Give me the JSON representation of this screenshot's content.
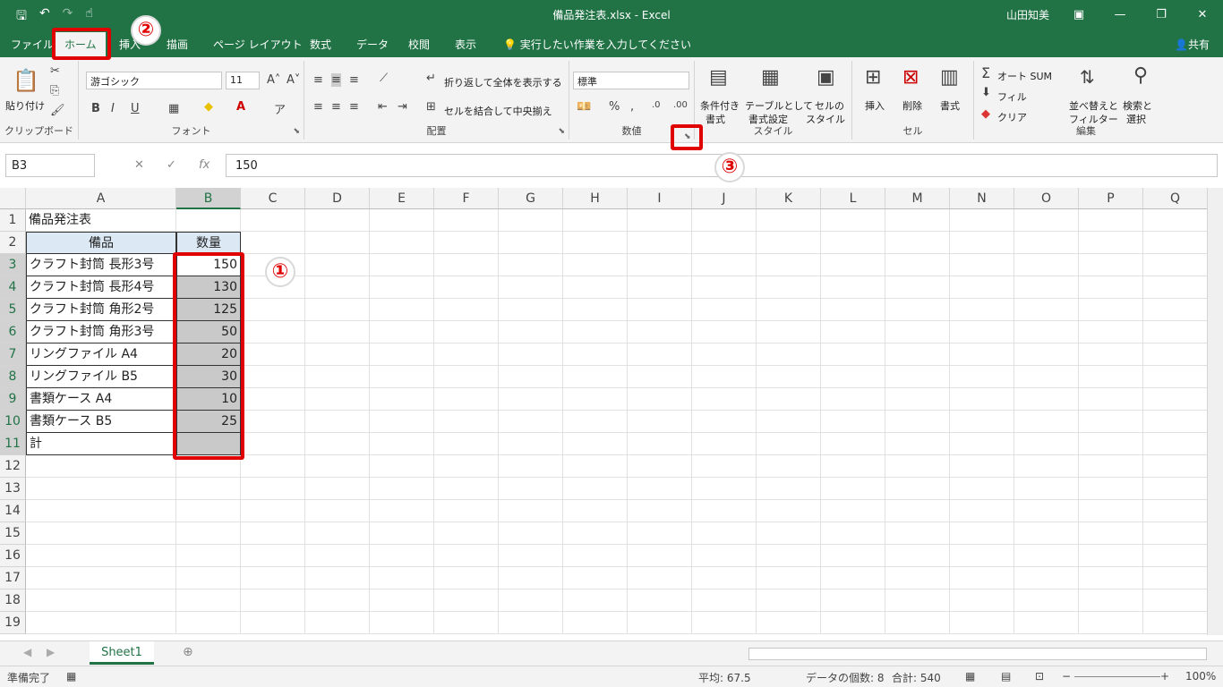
{
  "titlebar": {
    "title": "備品発注表.xlsx - Excel",
    "user": "山田知美"
  },
  "menu": {
    "tabs": [
      "ファイル",
      "ホーム",
      "挿入",
      "描画",
      "ページ レイアウト",
      "数式",
      "データ",
      "校閲",
      "表示"
    ],
    "tellme": "実行したい作業を入力してください",
    "share": "共有"
  },
  "ribbon": {
    "clipboard": {
      "paste": "貼り付け",
      "label": "クリップボード"
    },
    "font": {
      "name": "游ゴシック",
      "size": "11",
      "label": "フォント"
    },
    "align": {
      "wrap": "折り返して全体を表示する",
      "merge": "セルを結合して中央揃え",
      "label": "配置"
    },
    "number": {
      "format": "標準",
      "label": "数値"
    },
    "styles": {
      "cond1": "条件付き",
      "cond2": "書式",
      "table1": "テーブルとして",
      "table2": "書式設定",
      "cell1": "セルの",
      "cell2": "スタイル",
      "label": "スタイル"
    },
    "cells": {
      "insert": "挿入",
      "delete": "削除",
      "format": "書式",
      "label": "セル"
    },
    "editing": {
      "autosum": "オート SUM",
      "fill": "フィル",
      "clear": "クリア",
      "sort1": "並べ替えと",
      "sort2": "フィルター",
      "find1": "検索と",
      "find2": "選択",
      "label": "編集"
    }
  },
  "formula_bar": {
    "namebox": "B3",
    "value": "150"
  },
  "columns": [
    "A",
    "B",
    "C",
    "D",
    "E",
    "F",
    "G",
    "H",
    "I",
    "J",
    "K",
    "L",
    "M",
    "N",
    "O",
    "P",
    "Q"
  ],
  "rows": [
    "1",
    "2",
    "3",
    "4",
    "5",
    "6",
    "7",
    "8",
    "9",
    "10",
    "11",
    "12",
    "13",
    "14",
    "15",
    "16",
    "17",
    "18",
    "19"
  ],
  "sheet": {
    "title": "備品発注表",
    "header_item": "備品",
    "header_qty": "数量",
    "items": [
      {
        "name": "クラフト封筒 長形3号",
        "qty": "150"
      },
      {
        "name": "クラフト封筒 長形4号",
        "qty": "130"
      },
      {
        "name": "クラフト封筒 角形2号",
        "qty": "125"
      },
      {
        "name": "クラフト封筒 角形3号",
        "qty": "50"
      },
      {
        "name": "リングファイル A4",
        "qty": "20"
      },
      {
        "name": "リングファイル B5",
        "qty": "30"
      },
      {
        "name": "書類ケース A4",
        "qty": "10"
      },
      {
        "name": "書類ケース B5",
        "qty": "25"
      }
    ],
    "total_label": "計"
  },
  "annotations": {
    "one": "①",
    "two": "②",
    "three": "③"
  },
  "sheet_tab": "Sheet1",
  "status": {
    "ready": "準備完了",
    "average": "平均: 67.5",
    "count": "データの個数: 8",
    "sum": "合計: 540",
    "zoom": "100%"
  }
}
